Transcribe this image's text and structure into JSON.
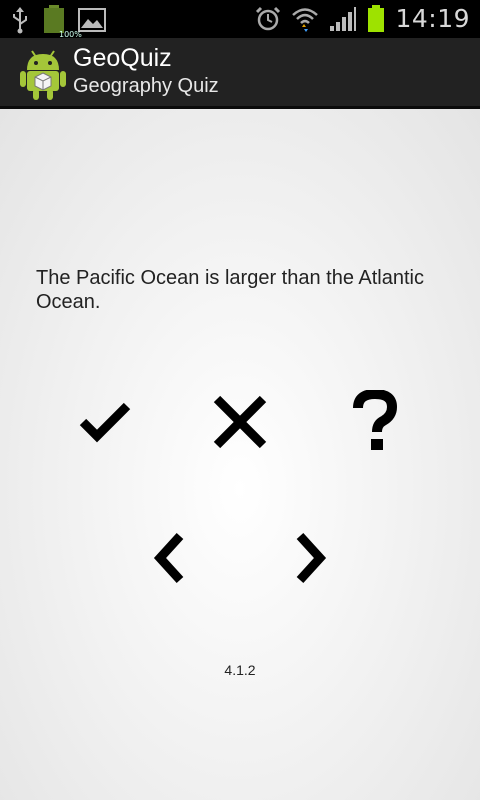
{
  "status_bar": {
    "time": "14:19",
    "battery_small_label": "100%",
    "icons": [
      "usb-icon",
      "battery-full-icon",
      "image-icon",
      "alarm-icon",
      "wifi-icon",
      "signal-icon",
      "battery-icon"
    ]
  },
  "action_bar": {
    "title": "GeoQuiz",
    "subtitle": "Geography Quiz",
    "app_icon": "android-icon"
  },
  "main": {
    "question": "The Pacific Ocean is larger than the Atlantic Ocean.",
    "buttons": {
      "true": "check-icon",
      "false": "x-icon",
      "cheat": "question-icon",
      "prev": "chevron-left-icon",
      "next": "chevron-right-icon"
    },
    "version": "4.1.2"
  },
  "colors": {
    "accent_battery": "#9ee200",
    "actionbar_bg": "#222222",
    "statusbar_bg": "#000000"
  }
}
